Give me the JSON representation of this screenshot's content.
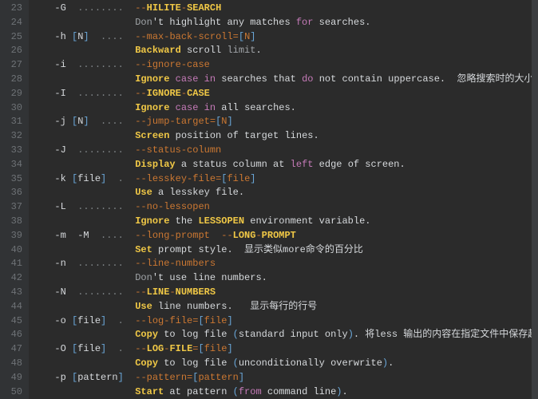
{
  "startLine": 23,
  "lines": [
    [
      [
        "c-flag",
        "  -G  "
      ],
      [
        "c-dots",
        "........  "
      ],
      [
        "c-long",
        "--"
      ],
      [
        "c-longY",
        "HILITE"
      ],
      [
        "c-long",
        "-"
      ],
      [
        "c-longY",
        "SEARCH"
      ]
    ],
    [
      [
        "c-text",
        "                Don"
      ],
      [
        "c-flag",
        "'t highlight any matches "
      ],
      [
        "c-kw",
        "for"
      ],
      [
        "c-flag",
        " searches."
      ]
    ],
    [
      [
        "c-flag",
        "  -h "
      ],
      [
        "c-num",
        "["
      ],
      [
        "c-flag",
        "N"
      ],
      [
        "c-num",
        "]"
      ],
      [
        "c-flag",
        "  "
      ],
      [
        "c-dots",
        "....  "
      ],
      [
        "c-long",
        "--max-back-scroll="
      ],
      [
        "c-num",
        "["
      ],
      [
        "c-long",
        "N"
      ],
      [
        "c-num",
        "]"
      ]
    ],
    [
      [
        "c-flag",
        "                "
      ],
      [
        "c-longY",
        "Backward"
      ],
      [
        "c-flag",
        " scroll "
      ],
      [
        "c-text",
        "limit"
      ],
      [
        "c-flag",
        "."
      ]
    ],
    [
      [
        "c-flag",
        "  -i  "
      ],
      [
        "c-dots",
        "........  "
      ],
      [
        "c-long",
        "--ignore-case"
      ]
    ],
    [
      [
        "c-flag",
        "                "
      ],
      [
        "c-longY",
        "Ignore"
      ],
      [
        "c-flag",
        " "
      ],
      [
        "c-kw",
        "case"
      ],
      [
        "c-flag",
        " "
      ],
      [
        "c-kw",
        "in"
      ],
      [
        "c-flag",
        " searches that "
      ],
      [
        "c-kw",
        "do"
      ],
      [
        "c-flag",
        " not contain uppercase.  "
      ],
      [
        "c-cn",
        "忽略搜索时的大小写"
      ]
    ],
    [
      [
        "c-flag",
        "  -I  "
      ],
      [
        "c-dots",
        "........  "
      ],
      [
        "c-long",
        "--"
      ],
      [
        "c-longY",
        "IGNORE"
      ],
      [
        "c-long",
        "-"
      ],
      [
        "c-longY",
        "CASE"
      ]
    ],
    [
      [
        "c-flag",
        "                "
      ],
      [
        "c-longY",
        "Ignore"
      ],
      [
        "c-flag",
        " "
      ],
      [
        "c-kw",
        "case"
      ],
      [
        "c-flag",
        " "
      ],
      [
        "c-kw",
        "in"
      ],
      [
        "c-flag",
        " all searches."
      ]
    ],
    [
      [
        "c-flag",
        "  -j "
      ],
      [
        "c-num",
        "["
      ],
      [
        "c-flag",
        "N"
      ],
      [
        "c-num",
        "]"
      ],
      [
        "c-flag",
        "  "
      ],
      [
        "c-dots",
        "....  "
      ],
      [
        "c-long",
        "--jump-target="
      ],
      [
        "c-num",
        "["
      ],
      [
        "c-long",
        "N"
      ],
      [
        "c-num",
        "]"
      ]
    ],
    [
      [
        "c-flag",
        "                "
      ],
      [
        "c-longY",
        "Screen"
      ],
      [
        "c-flag",
        " position of target lines."
      ]
    ],
    [
      [
        "c-flag",
        "  -J  "
      ],
      [
        "c-dots",
        "........  "
      ],
      [
        "c-long",
        "--status-column"
      ]
    ],
    [
      [
        "c-flag",
        "                "
      ],
      [
        "c-longY",
        "Display"
      ],
      [
        "c-flag",
        " a status column at "
      ],
      [
        "c-kw",
        "left"
      ],
      [
        "c-flag",
        " edge of screen."
      ]
    ],
    [
      [
        "c-flag",
        "  -k "
      ],
      [
        "c-num",
        "["
      ],
      [
        "c-flag",
        "file"
      ],
      [
        "c-num",
        "]"
      ],
      [
        "c-flag",
        "  "
      ],
      [
        "c-dots",
        ".  "
      ],
      [
        "c-long",
        "--lesskey-file="
      ],
      [
        "c-num",
        "["
      ],
      [
        "c-long",
        "file"
      ],
      [
        "c-num",
        "]"
      ]
    ],
    [
      [
        "c-flag",
        "                "
      ],
      [
        "c-longY",
        "Use"
      ],
      [
        "c-flag",
        " a lesskey file."
      ]
    ],
    [
      [
        "c-flag",
        "  -L  "
      ],
      [
        "c-dots",
        "........  "
      ],
      [
        "c-long",
        "--no-lessopen"
      ]
    ],
    [
      [
        "c-flag",
        "                "
      ],
      [
        "c-longY",
        "Ignore"
      ],
      [
        "c-flag",
        " the "
      ],
      [
        "c-longY",
        "LESSOPEN"
      ],
      [
        "c-flag",
        " environment variable."
      ]
    ],
    [
      [
        "c-flag",
        "  -m  -M  "
      ],
      [
        "c-dots",
        "....  "
      ],
      [
        "c-long",
        "--long-prompt  --"
      ],
      [
        "c-longY",
        "LONG"
      ],
      [
        "c-long",
        "-"
      ],
      [
        "c-longY",
        "PROMPT"
      ]
    ],
    [
      [
        "c-flag",
        "                "
      ],
      [
        "c-longY",
        "Set"
      ],
      [
        "c-flag",
        " prompt style.  "
      ],
      [
        "c-cn",
        "显示类似more命令的百分比"
      ]
    ],
    [
      [
        "c-flag",
        "  -n  "
      ],
      [
        "c-dots",
        "........  "
      ],
      [
        "c-long",
        "--line-numbers"
      ]
    ],
    [
      [
        "c-text",
        "                Don"
      ],
      [
        "c-flag",
        "'t use line numbers."
      ]
    ],
    [
      [
        "c-flag",
        "  -N  "
      ],
      [
        "c-dots",
        "........  "
      ],
      [
        "c-long",
        "--"
      ],
      [
        "c-longY",
        "LINE"
      ],
      [
        "c-long",
        "-"
      ],
      [
        "c-longY",
        "NUMBERS"
      ]
    ],
    [
      [
        "c-flag",
        "                "
      ],
      [
        "c-longY",
        "Use"
      ],
      [
        "c-flag",
        " line numbers.   "
      ],
      [
        "c-cn",
        "显示每行的行号"
      ]
    ],
    [
      [
        "c-flag",
        "  -o "
      ],
      [
        "c-num",
        "["
      ],
      [
        "c-flag",
        "file"
      ],
      [
        "c-num",
        "]"
      ],
      [
        "c-flag",
        "  "
      ],
      [
        "c-dots",
        ".  "
      ],
      [
        "c-long",
        "--log-file="
      ],
      [
        "c-num",
        "["
      ],
      [
        "c-long",
        "file"
      ],
      [
        "c-num",
        "]"
      ]
    ],
    [
      [
        "c-flag",
        "                "
      ],
      [
        "c-longY",
        "Copy"
      ],
      [
        "c-flag",
        " to log file "
      ],
      [
        "c-num",
        "("
      ],
      [
        "c-flag",
        "standard input only"
      ],
      [
        "c-num",
        ")"
      ],
      [
        "c-flag",
        ". "
      ],
      [
        "c-cn",
        "将less 输出的内容在指定文件中保存起来"
      ]
    ],
    [
      [
        "c-flag",
        "  -O "
      ],
      [
        "c-num",
        "["
      ],
      [
        "c-flag",
        "file"
      ],
      [
        "c-num",
        "]"
      ],
      [
        "c-flag",
        "  "
      ],
      [
        "c-dots",
        ".  "
      ],
      [
        "c-long",
        "--"
      ],
      [
        "c-longY",
        "LOG"
      ],
      [
        "c-long",
        "-"
      ],
      [
        "c-longY",
        "FILE"
      ],
      [
        "c-long",
        "="
      ],
      [
        "c-num",
        "["
      ],
      [
        "c-long",
        "file"
      ],
      [
        "c-num",
        "]"
      ]
    ],
    [
      [
        "c-flag",
        "                "
      ],
      [
        "c-longY",
        "Copy"
      ],
      [
        "c-flag",
        " to log file "
      ],
      [
        "c-num",
        "("
      ],
      [
        "c-flag",
        "unconditionally overwrite"
      ],
      [
        "c-num",
        ")"
      ],
      [
        "c-flag",
        "."
      ]
    ],
    [
      [
        "c-flag",
        "  -p "
      ],
      [
        "c-num",
        "["
      ],
      [
        "c-flag",
        "pattern"
      ],
      [
        "c-num",
        "]"
      ],
      [
        "c-flag",
        "  "
      ],
      [
        "c-long",
        "--pattern="
      ],
      [
        "c-num",
        "["
      ],
      [
        "c-long",
        "pattern"
      ],
      [
        "c-num",
        "]"
      ]
    ],
    [
      [
        "c-flag",
        "                "
      ],
      [
        "c-longY",
        "Start"
      ],
      [
        "c-flag",
        " at pattern "
      ],
      [
        "c-num",
        "("
      ],
      [
        "c-kw",
        "from"
      ],
      [
        "c-flag",
        " command line"
      ],
      [
        "c-num",
        ")"
      ],
      [
        "c-flag",
        "."
      ]
    ]
  ]
}
